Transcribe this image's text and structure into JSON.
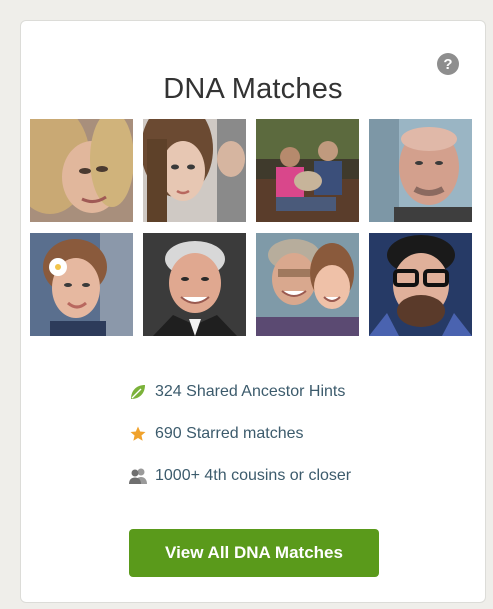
{
  "card": {
    "title": "DNA Matches",
    "help_symbol": "?"
  },
  "icons": {
    "help": "question-circle-icon",
    "hints": "leaf-icon",
    "starred": "star-icon",
    "cousins": "people-icon"
  },
  "stats": {
    "hints_label": "324 Shared Ancestor Hints",
    "starred_label": "690 Starred matches",
    "cousins_label": "1000+ 4th cousins or closer"
  },
  "button": {
    "label": "View All DNA Matches"
  },
  "colors": {
    "accent_green": "#5a9a1b",
    "leaf_green": "#7bb23a",
    "star_orange": "#f0a22c",
    "link_blue": "#3c5b6c"
  }
}
